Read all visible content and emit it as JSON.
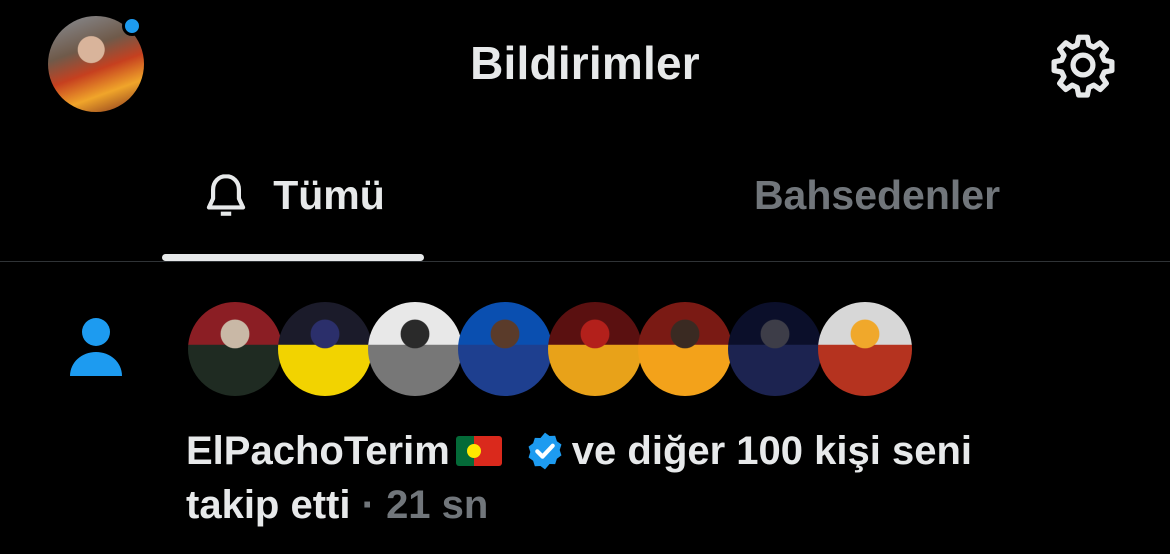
{
  "header": {
    "title": "Bildirimler",
    "profile_avatar_icon": "user-avatar",
    "settings_icon": "gear-icon",
    "unread_dot_color": "#1d9bf0"
  },
  "tabs": [
    {
      "label": "Tümü",
      "icon": "bell-icon",
      "active": true
    },
    {
      "label": "Bahsedenler",
      "active": false
    }
  ],
  "notification": {
    "type_icon": "person-icon",
    "type_icon_color": "#1d9bf0",
    "avatars": [
      {
        "name": "avatar-1",
        "colors": [
          "#8b1e24",
          "#1f2b22",
          "#c9b8a6"
        ]
      },
      {
        "name": "avatar-2",
        "colors": [
          "#1b1b2a",
          "#f2d300",
          "#2b2f6b"
        ]
      },
      {
        "name": "avatar-3",
        "colors": [
          "#e8e8e8",
          "#777777",
          "#2a2a2a"
        ]
      },
      {
        "name": "avatar-4",
        "colors": [
          "#0a4fb0",
          "#1e3f8f",
          "#5a3b2a"
        ]
      },
      {
        "name": "avatar-5",
        "colors": [
          "#5a1010",
          "#e8a219",
          "#b3201b"
        ]
      },
      {
        "name": "avatar-6",
        "colors": [
          "#7a1a14",
          "#f3a21a",
          "#3a2a22"
        ]
      },
      {
        "name": "avatar-7",
        "colors": [
          "#0b0f2a",
          "#1c2350",
          "#3d3d48"
        ]
      },
      {
        "name": "avatar-8",
        "colors": [
          "#d7d7d7",
          "#b5331f",
          "#f0a82b"
        ]
      }
    ],
    "user": "ElPachoTerim",
    "flag_icon": "portugal-flag-icon",
    "verified_icon": "verified-badge-icon",
    "verified_color": "#1d9bf0",
    "text": "ve diğer 100 kişi seni",
    "text_line2": "takip etti",
    "separator": "·",
    "time": "21 sn"
  }
}
